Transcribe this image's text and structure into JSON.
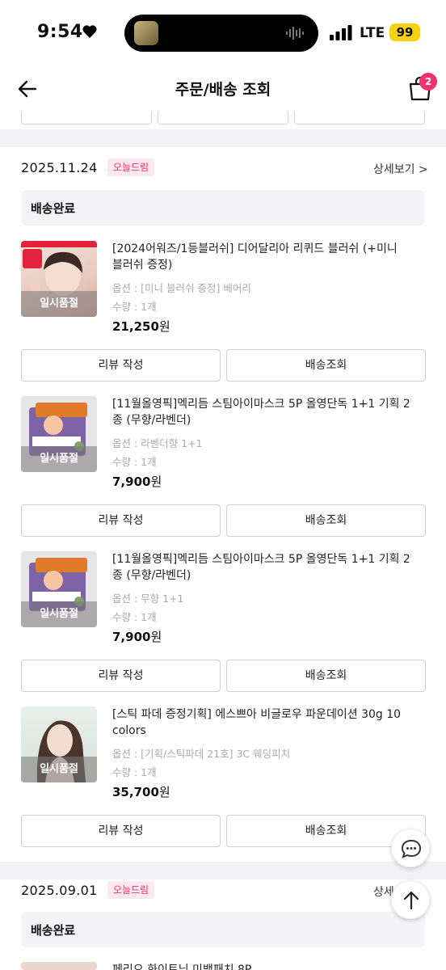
{
  "status_bar": {
    "time": "9:54",
    "network": "LTE",
    "battery": "99"
  },
  "header": {
    "title": "주문/배송 조회",
    "cart_count": "2"
  },
  "orders": [
    {
      "date": "2025.11.24",
      "tag": "오늘드림",
      "detail": "상세보기 >",
      "status": "배송완료",
      "items": [
        {
          "name": "[2024어워즈/1등블러쉬] 디어달리아 리퀴드 블러쉬 (+미니 블러쉬 증정)",
          "option": "옵션 : [미니 블러쉬 증정] 베어리",
          "qty": "수량 : 1개",
          "price": "21,250",
          "currency": "원",
          "soldout": "일시품절",
          "review": "리뷰 작성",
          "track": "배송조회"
        },
        {
          "name": "[11월올영픽]멕리듬 스팀아이마스크 5P 올영단독 1+1 기획 2종 (무향/라벤더)",
          "option": "옵션 : 라벤더향 1+1",
          "qty": "수량 : 1개",
          "price": "7,900",
          "currency": "원",
          "soldout": "일시품절",
          "review": "리뷰 작성",
          "track": "배송조회"
        },
        {
          "name": "[11월올영픽]멕리듬 스팀아이마스크 5P 올영단독 1+1 기획 2종 (무향/라벤더)",
          "option": "옵션 : 무향 1+1",
          "qty": "수량 : 1개",
          "price": "7,900",
          "currency": "원",
          "soldout": "일시품절",
          "review": "리뷰 작성",
          "track": "배송조회"
        },
        {
          "name": "[스틱 파데 증정기획] 에스쁘아 비글로우 파운데이션 30g 10 colors",
          "option": "옵션 : [기획/스틱파데 21호] 3C 웨딩피치",
          "qty": "수량 : 1개",
          "price": "35,700",
          "currency": "원",
          "soldout": "일시품절",
          "review": "리뷰 작성",
          "track": "배송조회"
        }
      ]
    },
    {
      "date": "2025.09.01",
      "tag": "오늘드림",
      "detail": "상세",
      "status": "배송완료",
      "partial_item": "페리오 화이트닝 미백패치 8P"
    }
  ],
  "icons": {
    "back": "arrow-left-icon",
    "cart": "shopping-bag-icon",
    "chat": "chat-bubble-icon",
    "top": "arrow-up-icon",
    "heart": "heart-icon",
    "signal": "signal-bars-icon"
  },
  "colors": {
    "accent": "#f0306f",
    "tag_bg": "#fde8ef",
    "battery": "#f5d313"
  }
}
